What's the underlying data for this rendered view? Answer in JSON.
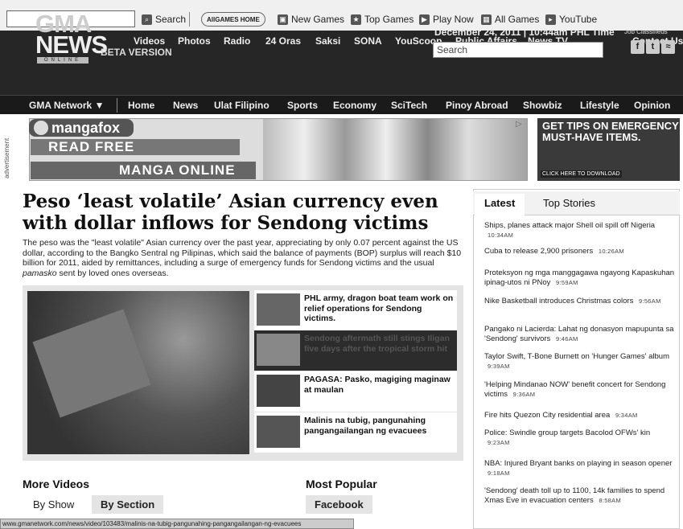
{
  "toolbar": {
    "search_label": "Search",
    "allgames_badge": "AllGAMES HOME",
    "links": [
      "New Games",
      "Top Games",
      "Play Now",
      "All Games",
      "YouTube"
    ]
  },
  "topnav": [
    "Videos",
    "Photos",
    "Radio",
    "24 Oras",
    "Saksi",
    "SONA",
    "YouScoop",
    "Public Affairs",
    "News TV",
    "Contact Us"
  ],
  "logo": {
    "line1": "GMA",
    "line2": "NEWS",
    "online": "ONLINE",
    "beta": "BETA VERSION"
  },
  "date": "December 24, 2011 | 10:44am PHL Time",
  "job_classifieds": "Job Classifieds",
  "search_placeholder": "Search",
  "mainnav": [
    "GMA Network ▼",
    "Home",
    "News",
    "Ulat Filipino",
    "Sports",
    "Economy",
    "SciTech",
    "Pinoy Abroad",
    "Showbiz",
    "Lifestyle",
    "Opinion"
  ],
  "ad": {
    "label": "advertisement",
    "brand": "mangafox",
    "read": "READ FREE",
    "manga": "MANGA ONLINE",
    "right_line1": "GET TIPS ON EMERGENCY",
    "right_line2": "MUST-HAVE ITEMS.",
    "right_cta": "CLICK HERE TO DOWNLOAD"
  },
  "article": {
    "headline": "Peso ‘least volatile’ Asian currency even with dollar inflows for Sendong victims",
    "lead_pre": "The peso was the \"least volatile\" Asian currency over the past year, appreciating by only 0.07 percent against the US dollar, according to the Bangko Sentral ng Pilipinas, which said the balance of payments (BOP) surplus will reach $10 billion for 2011, aided by remittances, including a surge of emergency funds for Sendong victims and the usual ",
    "lead_italic": "pamasko",
    "lead_post": " sent by loved ones overseas."
  },
  "related": [
    "PHL army, dragon boat team work on relief operations for Sendong victims.",
    "Sendong aftermath still stings Iligan five days after the tropical storm hit",
    "PAGASA: Pasko, magiging maginaw at maulan",
    "Malinis na tubig, pangunahing pangangailangan ng evacuees"
  ],
  "more_videos": {
    "title": "More Videos",
    "tabs": [
      "By Show",
      "By Section"
    ]
  },
  "most_popular": {
    "title": "Most Popular",
    "tab": "Facebook"
  },
  "sidebar": {
    "tabs": [
      "Latest",
      "Top Stories"
    ],
    "items": [
      {
        "text": "Ships, planes attack major Shell oil spill off Nigeria",
        "time": "10:34AM"
      },
      {
        "text": "Cuba to release 2,900 prisoners",
        "time": "10:26AM"
      },
      {
        "text": "Proteksyon ng mga manggagawa ngayong Kapaskuhan ipinag-utos ni PNoy",
        "time": "9:59AM"
      },
      {
        "text": "Nike Basketball introduces Christmas colors",
        "time": "9:56AM"
      },
      {
        "text": "Pangako ni Lacierda: Lahat ng donasyon mapupunta sa 'Sendong' survivors",
        "time": "9:46AM"
      },
      {
        "text": "Taylor Swift, T-Bone Burnett on 'Hunger Games' album",
        "time": "9:39AM"
      },
      {
        "text": "'Helping Mindanao NOW' benefit concert for Sendong victims",
        "time": "9:36AM"
      },
      {
        "text": "Fire hits Quezon City residential area",
        "time": "9:34AM"
      },
      {
        "text": "Police: Swindle group targets Bacolod OFWs' kin",
        "time": "9:23AM"
      },
      {
        "text": "NBA: Injured Bryant banks on playing in season opener",
        "time": "9:18AM"
      },
      {
        "text": "'Sendong' death toll up to 1100, 14k families to spend Xmas Eve in evacuation centers",
        "time": "8:58AM"
      }
    ]
  },
  "status_url": "www.gmanetwork.com/news/video/103483/malinis-na-tubig-pangunahing-pangangailangan-ng-evacuees"
}
